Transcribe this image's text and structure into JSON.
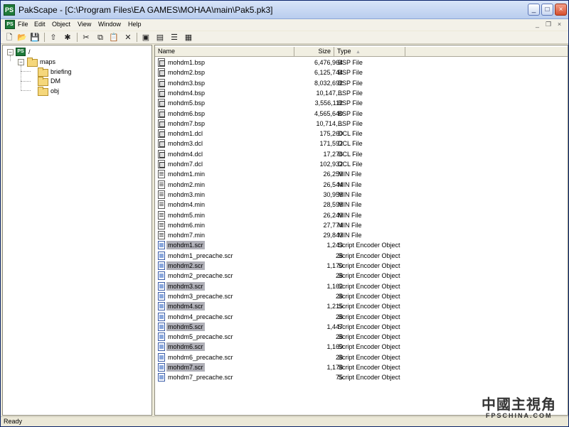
{
  "titlebar": {
    "app_icon_text": "PS",
    "title": "PakScape - [C:\\Program Files\\EA GAMES\\MOHAA\\main\\Pak5.pk3]",
    "minimize_glyph": "_",
    "maximize_glyph": "□",
    "close_glyph": "×"
  },
  "menubar": {
    "icon_text": "PS",
    "items": [
      "File",
      "Edit",
      "Object",
      "View",
      "Window",
      "Help"
    ],
    "mdi_minimize": "_",
    "mdi_restore": "❐",
    "mdi_close": "×"
  },
  "toolbar": {
    "icons": [
      "new-icon",
      "open-icon",
      "save-icon",
      "folder-up-icon",
      "new-folder-icon",
      "cut-icon",
      "copy-icon",
      "paste-icon",
      "delete-icon",
      "large-icons-icon",
      "small-icons-icon",
      "list-view-icon",
      "details-view-icon"
    ],
    "glyphs": [
      "🗋",
      "📂",
      "💾",
      "⇧",
      "✱",
      "✂",
      "⧉",
      "📋",
      "✕",
      "▣",
      "▤",
      "☰",
      "▦"
    ]
  },
  "tree": {
    "root": "/",
    "root_icon_text": "PS",
    "expander_minus": "−",
    "maps": "maps",
    "children": [
      "briefing",
      "DM",
      "obj"
    ]
  },
  "list": {
    "columns": {
      "name": "Name",
      "size": "Size",
      "type": "Type"
    },
    "sort_glyph": "▲",
    "files": [
      {
        "name": "mohdm1.bsp",
        "size": "6,476,964",
        "type": "BSP File",
        "kind": "bsp",
        "selected": false
      },
      {
        "name": "mohdm2.bsp",
        "size": "6,125,744",
        "type": "BSP File",
        "kind": "bsp",
        "selected": false
      },
      {
        "name": "mohdm3.bsp",
        "size": "8,032,692",
        "type": "BSP File",
        "kind": "bsp",
        "selected": false
      },
      {
        "name": "mohdm4.bsp",
        "size": "10,147,...",
        "type": "BSP File",
        "kind": "bsp",
        "selected": false
      },
      {
        "name": "mohdm5.bsp",
        "size": "3,556,112",
        "type": "BSP File",
        "kind": "bsp",
        "selected": false
      },
      {
        "name": "mohdm6.bsp",
        "size": "4,565,640",
        "type": "BSP File",
        "kind": "bsp",
        "selected": false
      },
      {
        "name": "mohdm7.bsp",
        "size": "10,714,...",
        "type": "BSP File",
        "kind": "bsp",
        "selected": false
      },
      {
        "name": "mohdm1.dcl",
        "size": "175,260",
        "type": "DCL File",
        "kind": "dcl",
        "selected": false
      },
      {
        "name": "mohdm3.dcl",
        "size": "171,592",
        "type": "DCL File",
        "kind": "dcl",
        "selected": false
      },
      {
        "name": "mohdm4.dcl",
        "size": "17,276",
        "type": "DCL File",
        "kind": "dcl",
        "selected": false
      },
      {
        "name": "mohdm7.dcl",
        "size": "102,932",
        "type": "DCL File",
        "kind": "dcl",
        "selected": false
      },
      {
        "name": "mohdm1.min",
        "size": "26,259",
        "type": "MIN File",
        "kind": "min",
        "selected": false
      },
      {
        "name": "mohdm2.min",
        "size": "26,544",
        "type": "MIN File",
        "kind": "min",
        "selected": false
      },
      {
        "name": "mohdm3.min",
        "size": "30,958",
        "type": "MIN File",
        "kind": "min",
        "selected": false
      },
      {
        "name": "mohdm4.min",
        "size": "28,598",
        "type": "MIN File",
        "kind": "min",
        "selected": false
      },
      {
        "name": "mohdm5.min",
        "size": "26,249",
        "type": "MIN File",
        "kind": "min",
        "selected": false
      },
      {
        "name": "mohdm6.min",
        "size": "27,774",
        "type": "MIN File",
        "kind": "min",
        "selected": false
      },
      {
        "name": "mohdm7.min",
        "size": "29,843",
        "type": "MIN File",
        "kind": "min",
        "selected": false
      },
      {
        "name": "mohdm1.scr",
        "size": "1,243",
        "type": "Script Encoder Object",
        "kind": "scr",
        "selected": true
      },
      {
        "name": "mohdm1_precache.scr",
        "size": "28",
        "type": "Script Encoder Object",
        "kind": "scr",
        "selected": false
      },
      {
        "name": "mohdm2.scr",
        "size": "1,170",
        "type": "Script Encoder Object",
        "kind": "scr",
        "selected": true
      },
      {
        "name": "mohdm2_precache.scr",
        "size": "28",
        "type": "Script Encoder Object",
        "kind": "scr",
        "selected": false
      },
      {
        "name": "mohdm3.scr",
        "size": "1,162",
        "type": "Script Encoder Object",
        "kind": "scr",
        "selected": true
      },
      {
        "name": "mohdm3_precache.scr",
        "size": "28",
        "type": "Script Encoder Object",
        "kind": "scr",
        "selected": false
      },
      {
        "name": "mohdm4.scr",
        "size": "1,215",
        "type": "Script Encoder Object",
        "kind": "scr",
        "selected": true
      },
      {
        "name": "mohdm4_precache.scr",
        "size": "28",
        "type": "Script Encoder Object",
        "kind": "scr",
        "selected": false
      },
      {
        "name": "mohdm5.scr",
        "size": "1,447",
        "type": "Script Encoder Object",
        "kind": "scr",
        "selected": true
      },
      {
        "name": "mohdm5_precache.scr",
        "size": "28",
        "type": "Script Encoder Object",
        "kind": "scr",
        "selected": false
      },
      {
        "name": "mohdm6.scr",
        "size": "1,169",
        "type": "Script Encoder Object",
        "kind": "scr",
        "selected": true
      },
      {
        "name": "mohdm6_precache.scr",
        "size": "28",
        "type": "Script Encoder Object",
        "kind": "scr",
        "selected": false
      },
      {
        "name": "mohdm7.scr",
        "size": "1,178",
        "type": "Script Encoder Object",
        "kind": "scr",
        "selected": true
      },
      {
        "name": "mohdm7_precache.scr",
        "size": "75",
        "type": "Script Encoder Object",
        "kind": "scr",
        "selected": false
      }
    ]
  },
  "status": {
    "text": "Ready"
  },
  "watermark": {
    "main": "中國主視角",
    "sub": "FPSCHINA.COM"
  },
  "colors": {
    "selection": "#b0b0b8",
    "titlebar": "#b9cdee",
    "app_icon": "#1f7a3a"
  }
}
